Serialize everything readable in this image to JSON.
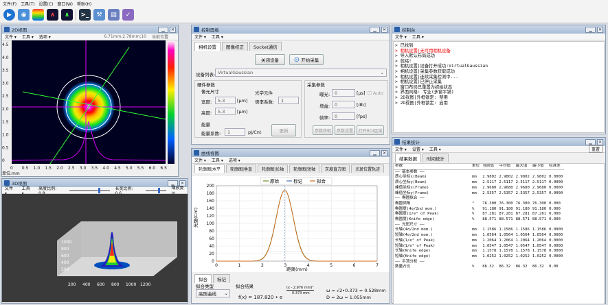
{
  "menubar": [
    "文件(F)",
    "工具(T)",
    "设置(C)",
    "窗口(W)",
    "帮助(H)"
  ],
  "viewer2d": {
    "title": "2D视图",
    "menu": [
      "文件 ▾",
      "工具 ▾",
      "选项 ▾"
    ],
    "info": "6.71mm,2.78mm;10",
    "info2": "当前位置",
    "unit": "单位:mm",
    "yticks": [
      "4.5",
      "4.0",
      "3.5",
      "3.0",
      "2.5",
      "2.0",
      "1.5",
      "1.0",
      "0.5",
      "0"
    ],
    "xticks": [
      "0",
      "0.5",
      "1.0",
      "1.5",
      "2.0",
      "2.5",
      "3.0",
      "3.5",
      "4.0",
      "4.5",
      "5.0",
      "5.5",
      "6.0",
      "6.5"
    ]
  },
  "viewer3d": {
    "title": "3D视图",
    "menu": [
      "文件 ▾",
      "工具 ▾"
    ],
    "ratio_label": "高度比例: 0.8",
    "ratio2_label": "长宽比例: 0.6",
    "reset": "缩放复位",
    "xticks": [
      "200",
      "400",
      "600",
      "800",
      "1000",
      "1200"
    ],
    "yticks": [
      "1000",
      "800",
      "600",
      "400",
      "200"
    ]
  },
  "camera": {
    "title": "控制面板",
    "menu": [
      "文件 ▾",
      "工具 ▾"
    ],
    "tabs": [
      "相机设置",
      "图像校正",
      "Socket通信"
    ],
    "close_btn": "关闭设备",
    "start_btn": "开始采集",
    "device_label": "设备列表:",
    "device_value": "VirtualGaussian",
    "hw_title": "硬件参数",
    "pixel_title": "像元尺寸",
    "width_label": "宽度:",
    "width_value": "5.3",
    "height_label": "高度:",
    "height_value": "5.3",
    "um": "[μm]",
    "optic_title": "光学元件",
    "mag_label": "倍率系数:",
    "mag_value": "1",
    "energy_title": "能量",
    "energy_label": "能量系数:",
    "energy_value": "1",
    "energy_unit": "pJ/Cnt",
    "update_btn": "更新",
    "acq_title": "采集参数",
    "exp_label": "曝光:",
    "exp_value": "0",
    "exp_unit": "[μs]",
    "auto_label": "Auto",
    "gain_label": "增益:",
    "gain_value": "0",
    "gain_unit": "[db]",
    "fps_label": "帧率:",
    "fps_value": "0",
    "fps_unit": "[fps]",
    "b1": "参数获取",
    "b2": "参数设置",
    "b3": "打开ROI区域"
  },
  "console": {
    "title": "控制台",
    "menu": [
      "文件 ▾",
      "工具 ▾"
    ],
    "lines": [
      {
        "t": "> 已找到",
        "red": false
      },
      {
        "t": "> 相机设置|无可用相机设备",
        "red": true
      },
      {
        "t": "> 导入默认布局成功",
        "red": false
      },
      {
        "t": "> 就绪!",
        "red": false
      },
      {
        "t": "> 相机设置|设备打开成功:VirtualGaussian",
        "red": false
      },
      {
        "t": "> 相机设置|采集参数获取成功",
        "red": false
      },
      {
        "t": "> 相机设置|连续采集检测中...",
        "red": false
      },
      {
        "t": "> 相机设置|已停止采集",
        "red": false
      },
      {
        "t": "> 窗口布局已重置为初始状态",
        "red": false
      },
      {
        "t": "> 界面风格: 专业(多窗平铺)",
        "red": false
      },
      {
        "t": "> 2D视图|外框锁定: 禁用",
        "red": false
      },
      {
        "t": "> 2D视图|外框锁定: 启用",
        "red": false
      }
    ]
  },
  "profile": {
    "title": "曲线视图",
    "menu": [
      "文件 ▾",
      "工具 ▾",
      "选项 ▾"
    ],
    "tabs": [
      "轮廓图|水平",
      "轮廓图|垂直",
      "轮廓图|长轴",
      "轮廓图|短轴",
      "灰度直方图",
      "光斑位置轨迹"
    ],
    "legend": [
      "原始",
      "标记",
      "拟合"
    ],
    "ylabel": "光强(Cnt)",
    "xlabel": "距离(mm)",
    "ftabs": [
      "拟合",
      "标记"
    ],
    "fit_type_label": "拟合类型",
    "fit_type_value": "高斯曲线",
    "fit_result_label": "拟合结果",
    "formula": "f(x) = 187.820 • e",
    "exponent": "(x - 2.976 mm)²",
    "denom": "0.373 mm",
    "w_line": "ω = √2•0.373 = 0.528mm",
    "d_line": "D = 2ω = 1.055mm"
  },
  "chart_data": {
    "type": "line",
    "title": "",
    "xlabel": "距离(mm)",
    "ylabel": "光强(Cnt)",
    "xlim": [
      0,
      7
    ],
    "ylim": [
      0,
      200
    ],
    "xticks": [
      0,
      1,
      2,
      3,
      4,
      5,
      6,
      7
    ],
    "yticks": [
      0,
      20,
      40,
      60,
      80,
      100,
      120,
      140,
      160,
      180,
      200
    ],
    "series": [
      {
        "name": "原始",
        "color": "#6b8e23",
        "peak_x": 2.976,
        "peak_y": 187.82,
        "sigma": 0.373
      },
      {
        "name": "拟合",
        "color": "#d2691e",
        "peak_x": 2.976,
        "peak_y": 187.82,
        "sigma": 0.373
      }
    ]
  },
  "stats": {
    "title": "结果统计",
    "menu": [
      "文件 ▾",
      "设置 ▾",
      "工具 ▾"
    ],
    "reset": "重置",
    "tabs": [
      "结果数据",
      "时间统计"
    ],
    "headers": [
      "参数",
      "单位",
      "当前值",
      "平均值",
      "最大值",
      "最小值",
      "标准差"
    ],
    "rows": [
      [
        "—— 基本参数 ——",
        "",
        "",
        "",
        "",
        "",
        ""
      ],
      [
        "质心坐标x(Beam)",
        "mm",
        "2.9802",
        "2.9802",
        "2.9802",
        "2.9802",
        "0.0000"
      ],
      [
        "质心坐标y(Beam)",
        "mm",
        "2.5117",
        "2.5117",
        "2.5117",
        "2.5117",
        "0.0000"
      ],
      [
        "峰值坐标x(Frame)",
        "mm",
        "2.9680",
        "2.9680",
        "2.9680",
        "2.9680",
        "0.0000"
      ],
      [
        "峰值坐标y(Frame)",
        "mm",
        "2.5357",
        "2.5357",
        "2.5357",
        "2.5357",
        "0.0000"
      ],
      [
        "—— 椭圆拟合 ——",
        "",
        "",
        "",
        "",
        "",
        ""
      ],
      [
        "椭圆倾角",
        "°",
        "76.300",
        "76.300",
        "76.300",
        "76.300",
        "0.000"
      ],
      [
        "椭圆度(4σ/2nd mom.)",
        "%",
        "91.180",
        "91.180",
        "91.180",
        "91.180",
        "0.000"
      ],
      [
        "椭圆度(1/e² of Peak)",
        "%",
        "87.281",
        "87.281",
        "87.281",
        "87.281",
        "0.000"
      ],
      [
        "椭圆度(Knife edge)",
        "%",
        "88.571",
        "88.571",
        "88.571",
        "88.571",
        "0.000"
      ],
      [
        "—— 光斑尺寸 ——",
        "",
        "",
        "",
        "",
        "",
        ""
      ],
      [
        "长轴(4σ/2nd mom.)",
        "mm",
        "1.1586",
        "1.1586",
        "1.1586",
        "1.1586",
        "0.0000"
      ],
      [
        "短轴(4σ/2nd mom.)",
        "mm",
        "1.0564",
        "1.0564",
        "1.0564",
        "1.0564",
        "0.0000"
      ],
      [
        "长轴(1/e² of Peak)",
        "mm",
        "1.2064",
        "1.2064",
        "1.2064",
        "1.2064",
        "0.0000"
      ],
      [
        "短轴(1/e² of Peak)",
        "mm",
        "1.0547",
        "1.0547",
        "1.0547",
        "1.0547",
        "0.0000"
      ],
      [
        "长轴(Knife edge)",
        "mm",
        "1.1578",
        "1.1578",
        "1.1578",
        "1.1578",
        "0.0000"
      ],
      [
        "短轴(Knife edge)",
        "mm",
        "1.0252",
        "1.0252",
        "1.0252",
        "1.0252",
        "0.0000"
      ],
      [
        "—— 平顶分析 ——",
        "",
        "",
        "",
        "",
        "",
        ""
      ],
      [
        "数量占比",
        "%",
        "86.32",
        "86.32",
        "86.32",
        "86.32",
        "0.00"
      ]
    ]
  }
}
